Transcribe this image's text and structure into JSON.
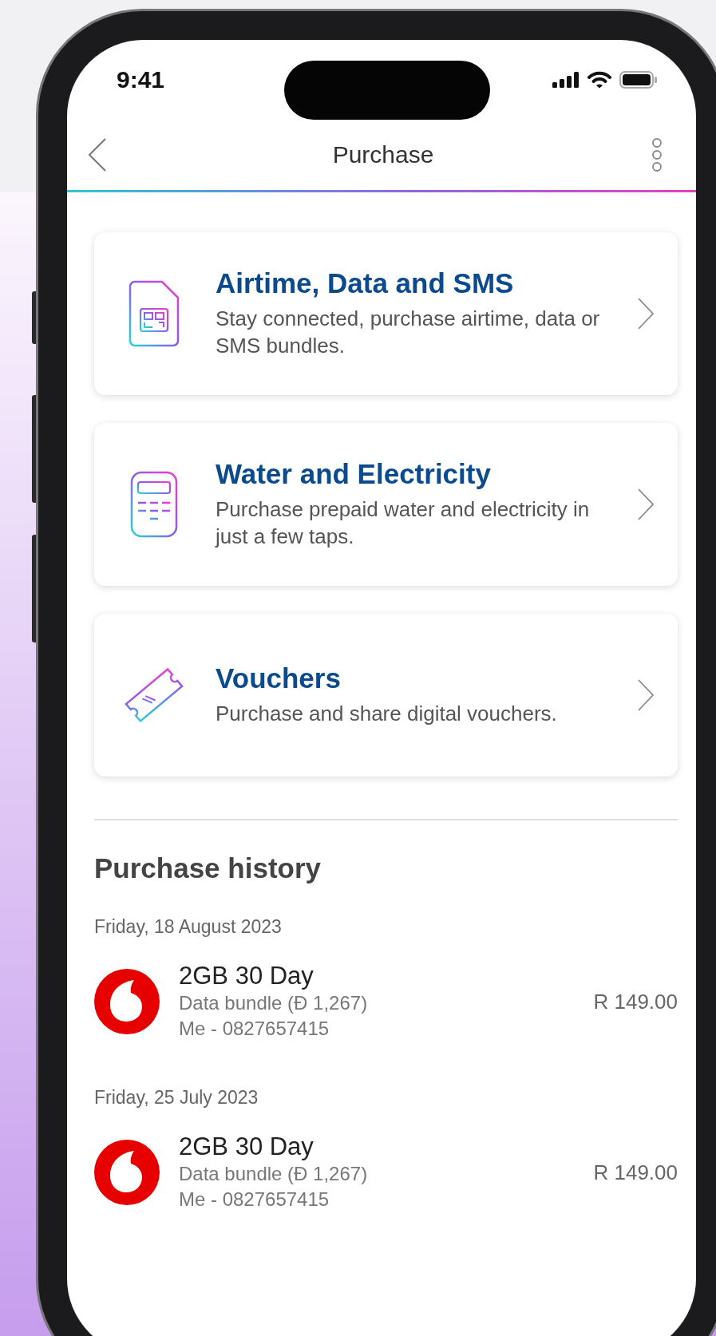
{
  "status_bar": {
    "time": "9:41"
  },
  "nav": {
    "title": "Purchase"
  },
  "options": [
    {
      "kind": "sim",
      "title": "Airtime, Data and SMS",
      "description": "Stay connected, purchase airtime, data or SMS bundles."
    },
    {
      "kind": "meter",
      "title": "Water and Electricity",
      "description": "Purchase prepaid water and electricity in just a few taps."
    },
    {
      "kind": "ticket",
      "title": "Vouchers",
      "description": "Purchase and share digital vouchers."
    }
  ],
  "history": {
    "heading": "Purchase history",
    "groups": [
      {
        "date": "Friday, 18 August 2023",
        "items": [
          {
            "name": "2GB 30 Day",
            "detail": "Data bundle (Đ 1,267)",
            "recipient": "Me - 0827657415",
            "amount": "R 149.00"
          }
        ]
      },
      {
        "date": "Friday, 25 July 2023",
        "items": [
          {
            "name": "2GB 30 Day",
            "detail": "Data bundle (Đ 1,267)",
            "recipient": "Me - 0827657415",
            "amount": "R 149.00"
          }
        ]
      }
    ]
  }
}
